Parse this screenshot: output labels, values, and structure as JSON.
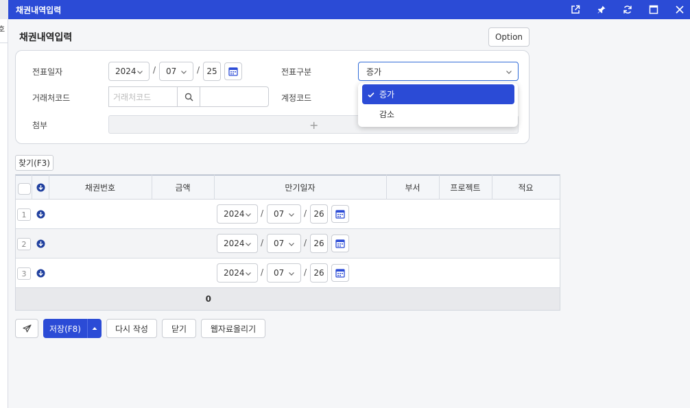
{
  "background_window": {
    "fragment_text": "호"
  },
  "titlebar": {
    "title": "채권내역입력",
    "icons": [
      "external-link-icon",
      "pin-icon",
      "refresh-icon",
      "maximize-icon",
      "close-icon"
    ],
    "color": "#2b4bd6"
  },
  "page": {
    "title": "채권내역입력",
    "option_label": "Option"
  },
  "form": {
    "voucher_date": {
      "label": "전표일자",
      "year": "2024",
      "month": "07",
      "day": "25"
    },
    "voucher_type": {
      "label": "전표구분",
      "selected": "증가",
      "options": [
        "증가",
        "감소"
      ]
    },
    "customer_code": {
      "label": "거래처코드",
      "placeholder": "거래처코드",
      "name_value": ""
    },
    "account_code": {
      "label": "계정코드"
    },
    "attachment": {
      "label": "첨부",
      "add_symbol": "+"
    }
  },
  "find_button": "찾기(F3)",
  "grid": {
    "columns": [
      "채권번호",
      "금액",
      "만기일자",
      "부서",
      "프로젝트",
      "적요"
    ],
    "rows": [
      {
        "no": "1",
        "bond_no": "",
        "amount": "",
        "year": "2024",
        "month": "07",
        "day": "26",
        "dept": "",
        "project": "",
        "memo": ""
      },
      {
        "no": "2",
        "bond_no": "",
        "amount": "",
        "year": "2024",
        "month": "07",
        "day": "26",
        "dept": "",
        "project": "",
        "memo": ""
      },
      {
        "no": "3",
        "bond_no": "",
        "amount": "",
        "year": "2024",
        "month": "07",
        "day": "26",
        "dept": "",
        "project": "",
        "memo": ""
      }
    ],
    "total_amount": "0"
  },
  "bottom_buttons": {
    "save": "저장(F8)",
    "rewrite": "다시 작성",
    "close": "닫기",
    "web_upload": "웹자료올리기"
  },
  "colors": {
    "accent": "#2b4bd6",
    "focus_border": "#2f6bd8"
  }
}
